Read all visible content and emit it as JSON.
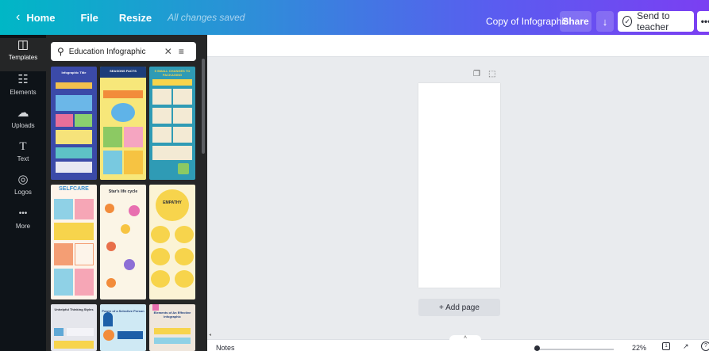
{
  "header": {
    "home_label": "Home",
    "file_label": "File",
    "resize_label": "Resize",
    "save_status": "All changes saved",
    "doc_title": "Copy of Infographic",
    "share_label": "Share",
    "teacher_label": "Send to teacher"
  },
  "rail": {
    "items": [
      {
        "label": "Templates",
        "icon": "templates-icon"
      },
      {
        "label": "Elements",
        "icon": "elements-icon"
      },
      {
        "label": "Uploads",
        "icon": "uploads-icon"
      },
      {
        "label": "Text",
        "icon": "text-icon"
      },
      {
        "label": "Logos",
        "icon": "logos-icon"
      },
      {
        "label": "More",
        "icon": "more-icon"
      }
    ]
  },
  "search": {
    "value": "Education Infographic"
  },
  "templates": [
    {
      "title": "Infographic Title"
    },
    {
      "title": "SEASONS FACTS"
    },
    {
      "title": "5 SMALL CHANGES TO PACKAGING"
    },
    {
      "title": "SELFCARE"
    },
    {
      "title": "Star's life cycle"
    },
    {
      "title": "EMPATHY"
    },
    {
      "title": "Unhelpful Thinking Styles"
    },
    {
      "title": "Power of a Selective Person"
    },
    {
      "title": "Elements of An Effective Infographic"
    }
  ],
  "canvas": {
    "add_page_label": "+ Add page"
  },
  "bottom": {
    "notes_label": "Notes",
    "zoom_value": "22%",
    "pages_count": "1"
  },
  "colors": {
    "header_gradient_start": "#00b7c6",
    "header_gradient_end": "#7b3ff2",
    "rail_bg": "#0e1318",
    "panel_bg": "#252627",
    "canvas_bg": "#e9ebee"
  }
}
